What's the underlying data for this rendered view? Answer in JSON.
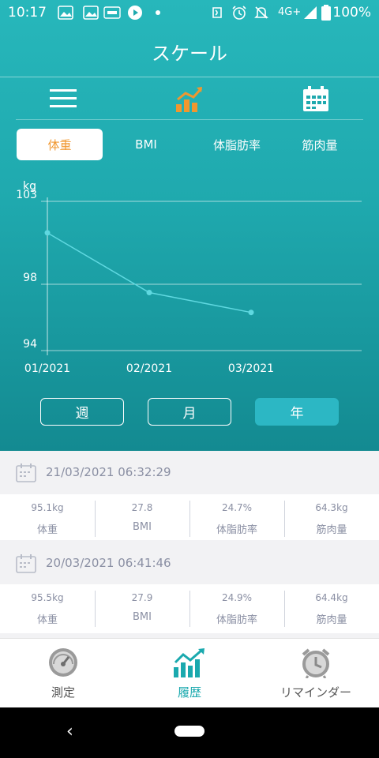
{
  "status_bar": {
    "time": "10:17",
    "network": "4G+",
    "battery": "100%",
    "icons": [
      "gallery-icon",
      "gallery-icon",
      "docomo-icon",
      "play-icon",
      "dot-icon",
      "nfc-icon",
      "alarm-icon",
      "mute-icon",
      "signal-icon",
      "battery-icon"
    ]
  },
  "header": {
    "title": "スケール"
  },
  "toolbar": {
    "icons": [
      "list-icon",
      "chart-icon",
      "calendar-icon"
    ],
    "active_color": "#f0972f"
  },
  "metric_tabs": [
    {
      "label": "体重",
      "active": true
    },
    {
      "label": "BMI",
      "active": false
    },
    {
      "label": "体脂肪率",
      "active": false
    },
    {
      "label": "筋肉量",
      "active": false
    }
  ],
  "chart_data": {
    "type": "line",
    "ylabel": "kg",
    "ylim": [
      94,
      103
    ],
    "yticks": [
      "103",
      "98",
      "94"
    ],
    "categories": [
      "01/2021",
      "02/2021",
      "03/2021"
    ],
    "series": [
      {
        "values": [
          101.1,
          97.5,
          96.3
        ]
      }
    ],
    "grid": true,
    "line_color": "#5fd8e0"
  },
  "period_buttons": [
    {
      "label": "週",
      "active": false
    },
    {
      "label": "月",
      "active": false
    },
    {
      "label": "年",
      "active": true
    }
  ],
  "records": [
    {
      "datetime": "21/03/2021  06:32:29",
      "cells": [
        {
          "value": "95.1kg",
          "label": "体重"
        },
        {
          "value": "27.8",
          "label": "BMI"
        },
        {
          "value": "24.7%",
          "label": "体脂肪率"
        },
        {
          "value": "64.3kg",
          "label": "筋肉量"
        }
      ]
    },
    {
      "datetime": "20/03/2021  06:41:46",
      "cells": [
        {
          "value": "95.5kg",
          "label": "体重"
        },
        {
          "value": "27.9",
          "label": "BMI"
        },
        {
          "value": "24.9%",
          "label": "体脂肪率"
        },
        {
          "value": "64.4kg",
          "label": "筋肉量"
        }
      ]
    }
  ],
  "bottom_nav": [
    {
      "label": "測定",
      "icon": "gauge-icon",
      "active": false
    },
    {
      "label": "履歴",
      "icon": "trend-icon",
      "active": true
    },
    {
      "label": "リマインダー",
      "icon": "alarm-clock-icon",
      "active": false
    }
  ],
  "system_nav": {
    "back": "‹"
  }
}
